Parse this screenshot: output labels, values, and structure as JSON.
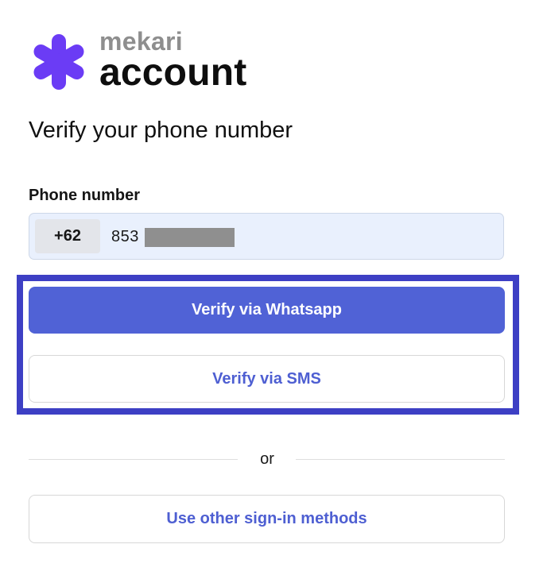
{
  "brand": {
    "name": "mekari",
    "product": "account",
    "logo_icon": "asterisk-logo-icon",
    "accent_color": "#6b3cf5"
  },
  "title": "Verify your phone number",
  "phone": {
    "label": "Phone number",
    "country_code": "+62",
    "value": "853"
  },
  "actions": {
    "verify_whatsapp": "Verify via Whatsapp",
    "verify_sms": "Verify via SMS",
    "primary_color": "#5062d6",
    "highlight_color": "#3d3fc4"
  },
  "divider": {
    "text": "or"
  },
  "other_methods": "Use other sign-in methods"
}
